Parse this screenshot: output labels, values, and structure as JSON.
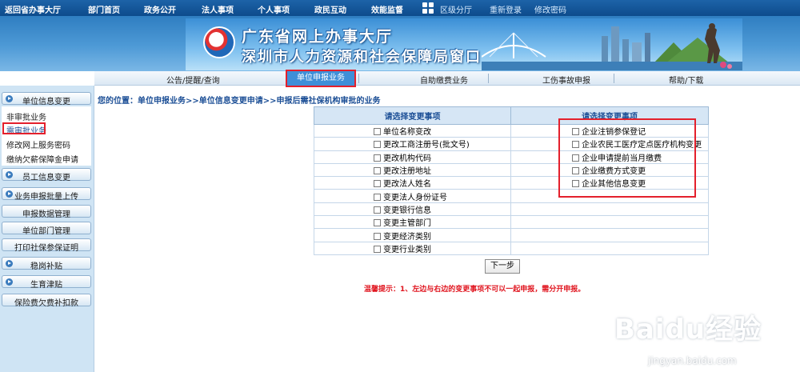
{
  "top_nav": {
    "items": [
      "返回省办事大厅",
      "部门首页",
      "政务公开",
      "法人事项",
      "个人事项",
      "政民互动",
      "效能监督"
    ],
    "right_links": [
      "区级分厅",
      "重新登录",
      "修改密码"
    ]
  },
  "banner": {
    "title_line1": "广东省网上办事大厅",
    "title_line2": "深圳市人力资源和社会保障局窗口"
  },
  "tabs": {
    "items": [
      "公告/提醒/查询",
      "单位申报业务",
      "自助缴费业务",
      "工伤事故申报",
      "帮助/下载"
    ],
    "active": "单位申报业务"
  },
  "sidebar": {
    "sections": [
      {
        "label": "单位信息变更",
        "has_arrow": true
      },
      {
        "label": "员工信息变更",
        "has_arrow": true
      },
      {
        "label": "业务申报批量上传",
        "has_arrow": true
      },
      {
        "label": "申报数据管理",
        "has_arrow": false
      },
      {
        "label": "单位部门管理",
        "has_arrow": false
      },
      {
        "label": "打印社保参保证明",
        "has_arrow": false
      },
      {
        "label": "稳岗补贴",
        "has_arrow": true
      },
      {
        "label": "生育津贴",
        "has_arrow": true
      },
      {
        "label": "保险费欠费补扣款",
        "has_arrow": false
      }
    ],
    "sub_links": [
      "非审批业务",
      "需审批业务",
      "修改网上服务密码",
      "缴纳欠薪保障金申请"
    ],
    "selected_sub": "需审批业务"
  },
  "breadcrumb": "您的位置：单位申报业务>>单位信息变更申请>>申报后需社保机构审批的业务",
  "table": {
    "headers": [
      "请选择变更事项",
      "请选择变更事项"
    ],
    "left_items": [
      "单位名称变改",
      "更改工商注册号(批文号)",
      "更改机构代码",
      "更改注册地址",
      "更改法人姓名",
      "变更法人身份证号",
      "变更银行信息",
      "变更主管部门",
      "变更经济类别",
      "变更行业类别"
    ],
    "right_items": [
      "企业注销参保登记",
      "企业农民工医疗定点医疗机构变更",
      "企业申请提前当月缴费",
      "企业缴费方式变更",
      "企业其他信息变更"
    ]
  },
  "next_button": "下一步",
  "hint": "温馨提示：1、左边与右边的变更事项不可以一起申报，需分开申报。",
  "watermark": {
    "brand": "Baidu经验",
    "url": "jingyan.baidu.com"
  },
  "colors": {
    "nav": "#0d4b8c",
    "accent_red": "#e4202c",
    "link_blue": "#1c4f96"
  }
}
